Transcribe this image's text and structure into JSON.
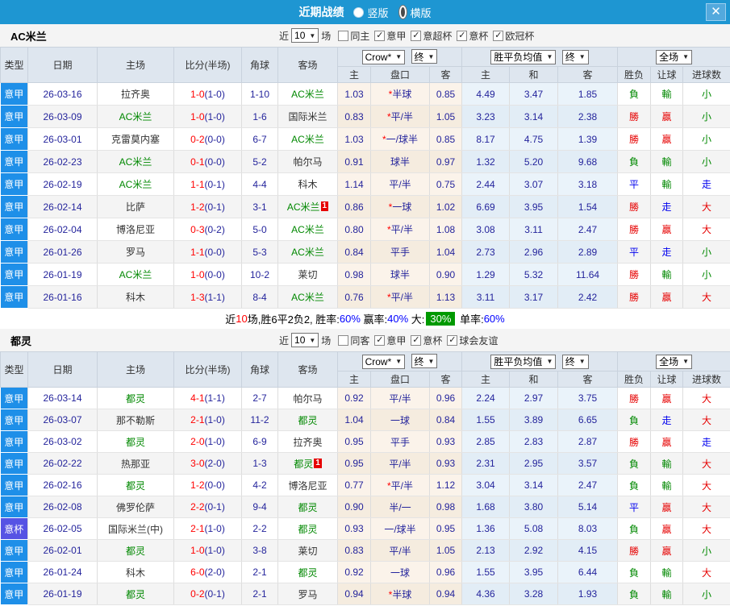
{
  "titlebar": {
    "title": "近期战绩",
    "layout_options": [
      {
        "label": "竖版",
        "selected": false
      },
      {
        "label": "横版",
        "selected": true
      }
    ],
    "close_label": "✕"
  },
  "colors": {
    "titlebar_bg": "#1e96d2",
    "league_serie_a": "#1e8fe8",
    "league_cup": "#5653e4",
    "focus_team": "#008800",
    "win": "#e60000",
    "lose": "#008800",
    "draw": "#0000ee",
    "score": "#ff0000",
    "numbers": "#24249c",
    "summary_badge_bg": "#009900"
  },
  "columns": {
    "left": [
      "类型",
      "日期",
      "主场",
      "比分(半场)",
      "角球",
      "客场"
    ],
    "odds_select": "Crow*",
    "odds_final_select": "终",
    "odds_sub": [
      "主",
      "盘口",
      "客"
    ],
    "mean_select": "胜平负均值",
    "mean_final_select": "终",
    "mean_sub": [
      "主",
      "和",
      "客"
    ],
    "full_select": "全场",
    "result_sub": [
      "胜负",
      "让球",
      "进球数"
    ]
  },
  "sections": [
    {
      "team": "AC米兰",
      "filter": {
        "near": "近",
        "count": "10",
        "games": "场",
        "checkboxes": [
          {
            "label": "同主",
            "checked": false
          },
          {
            "label": "意甲",
            "checked": true
          },
          {
            "label": "意超杯",
            "checked": true
          },
          {
            "label": "意杯",
            "checked": true
          },
          {
            "label": "欧冠杯",
            "checked": true
          }
        ]
      },
      "rows": [
        {
          "lg": "意甲",
          "lgc": "blue",
          "date": "26-03-16",
          "home": "拉齐奥",
          "hf": false,
          "hb": "",
          "score": "1-0",
          "half": "(1-0)",
          "corner": "1-10",
          "away": "AC米兰",
          "af": true,
          "ab": "",
          "o1": "1.03",
          "pan": "*半球",
          "o2": "0.85",
          "m1": "4.49",
          "m2": "3.47",
          "m3": "1.85",
          "r1": "負",
          "r1c": "g",
          "r2": "輸",
          "r2c": "g",
          "r3": "小",
          "r3c": "g"
        },
        {
          "lg": "意甲",
          "lgc": "blue",
          "date": "26-03-09",
          "home": "AC米兰",
          "hf": true,
          "hb": "",
          "score": "1-0",
          "half": "(1-0)",
          "corner": "1-6",
          "away": "国际米兰",
          "af": false,
          "ab": "",
          "o1": "0.83",
          "pan": "*平/半",
          "o2": "1.05",
          "m1": "3.23",
          "m2": "3.14",
          "m3": "2.38",
          "r1": "勝",
          "r1c": "r",
          "r2": "贏",
          "r2c": "r",
          "r3": "小",
          "r3c": "g"
        },
        {
          "lg": "意甲",
          "lgc": "blue",
          "date": "26-03-01",
          "home": "克雷莫内塞",
          "hf": false,
          "hb": "",
          "score": "0-2",
          "half": "(0-0)",
          "corner": "6-7",
          "away": "AC米兰",
          "af": true,
          "ab": "",
          "o1": "1.03",
          "pan": "*一/球半",
          "o2": "0.85",
          "m1": "8.17",
          "m2": "4.75",
          "m3": "1.39",
          "r1": "勝",
          "r1c": "r",
          "r2": "贏",
          "r2c": "r",
          "r3": "小",
          "r3c": "g"
        },
        {
          "lg": "意甲",
          "lgc": "blue",
          "date": "26-02-23",
          "home": "AC米兰",
          "hf": true,
          "hb": "",
          "score": "0-1",
          "half": "(0-0)",
          "corner": "5-2",
          "away": "帕尔马",
          "af": false,
          "ab": "",
          "o1": "0.91",
          "pan": "球半",
          "o2": "0.97",
          "m1": "1.32",
          "m2": "5.20",
          "m3": "9.68",
          "r1": "負",
          "r1c": "g",
          "r2": "輸",
          "r2c": "g",
          "r3": "小",
          "r3c": "g"
        },
        {
          "lg": "意甲",
          "lgc": "blue",
          "date": "26-02-19",
          "home": "AC米兰",
          "hf": true,
          "hb": "",
          "score": "1-1",
          "half": "(0-1)",
          "corner": "4-4",
          "away": "科木",
          "af": false,
          "ab": "",
          "o1": "1.14",
          "pan": "平/半",
          "o2": "0.75",
          "m1": "2.44",
          "m2": "3.07",
          "m3": "3.18",
          "r1": "平",
          "r1c": "b",
          "r2": "輸",
          "r2c": "g",
          "r3": "走",
          "r3c": "b"
        },
        {
          "lg": "意甲",
          "lgc": "blue",
          "date": "26-02-14",
          "home": "比萨",
          "hf": false,
          "hb": "",
          "score": "1-2",
          "half": "(0-1)",
          "corner": "3-1",
          "away": "AC米兰",
          "af": true,
          "ab": "1",
          "o1": "0.86",
          "pan": "*一球",
          "o2": "1.02",
          "m1": "6.69",
          "m2": "3.95",
          "m3": "1.54",
          "r1": "勝",
          "r1c": "r",
          "r2": "走",
          "r2c": "b",
          "r3": "大",
          "r3c": "r"
        },
        {
          "lg": "意甲",
          "lgc": "blue",
          "date": "26-02-04",
          "home": "博洛尼亚",
          "hf": false,
          "hb": "",
          "score": "0-3",
          "half": "(0-2)",
          "corner": "5-0",
          "away": "AC米兰",
          "af": true,
          "ab": "",
          "o1": "0.80",
          "pan": "*平/半",
          "o2": "1.08",
          "m1": "3.08",
          "m2": "3.11",
          "m3": "2.47",
          "r1": "勝",
          "r1c": "r",
          "r2": "贏",
          "r2c": "r",
          "r3": "大",
          "r3c": "r"
        },
        {
          "lg": "意甲",
          "lgc": "blue",
          "date": "26-01-26",
          "home": "罗马",
          "hf": false,
          "hb": "",
          "score": "1-1",
          "half": "(0-0)",
          "corner": "5-3",
          "away": "AC米兰",
          "af": true,
          "ab": "",
          "o1": "0.84",
          "pan": "平手",
          "o2": "1.04",
          "m1": "2.73",
          "m2": "2.96",
          "m3": "2.89",
          "r1": "平",
          "r1c": "b",
          "r2": "走",
          "r2c": "b",
          "r3": "小",
          "r3c": "g"
        },
        {
          "lg": "意甲",
          "lgc": "blue",
          "date": "26-01-19",
          "home": "AC米兰",
          "hf": true,
          "hb": "",
          "score": "1-0",
          "half": "(0-0)",
          "corner": "10-2",
          "away": "莱切",
          "af": false,
          "ab": "",
          "o1": "0.98",
          "pan": "球半",
          "o2": "0.90",
          "m1": "1.29",
          "m2": "5.32",
          "m3": "11.64",
          "r1": "勝",
          "r1c": "r",
          "r2": "輸",
          "r2c": "g",
          "r3": "小",
          "r3c": "g"
        },
        {
          "lg": "意甲",
          "lgc": "blue",
          "date": "26-01-16",
          "home": "科木",
          "hf": false,
          "hb": "",
          "score": "1-3",
          "half": "(1-1)",
          "corner": "8-4",
          "away": "AC米兰",
          "af": true,
          "ab": "",
          "o1": "0.76",
          "pan": "*平/半",
          "o2": "1.13",
          "m1": "3.11",
          "m2": "3.17",
          "m3": "2.42",
          "r1": "勝",
          "r1c": "r",
          "r2": "贏",
          "r2c": "r",
          "r3": "大",
          "r3c": "r"
        }
      ],
      "summary": [
        {
          "t": "近",
          "c": "k"
        },
        {
          "t": "10",
          "c": "r"
        },
        {
          "t": "场,胜6平2负2, 胜率:",
          "c": "k"
        },
        {
          "t": "60%",
          "c": "b"
        },
        {
          "t": " 赢率:",
          "c": "k"
        },
        {
          "t": "40%",
          "c": "b"
        },
        {
          "t": " 大:",
          "c": "k"
        },
        {
          "t": "30%",
          "c": "g"
        },
        {
          "t": " 单率:",
          "c": "k"
        },
        {
          "t": "60%",
          "c": "b"
        }
      ]
    },
    {
      "team": "都灵",
      "filter": {
        "near": "近",
        "count": "10",
        "games": "场",
        "checkboxes": [
          {
            "label": "同客",
            "checked": false
          },
          {
            "label": "意甲",
            "checked": true
          },
          {
            "label": "意杯",
            "checked": true
          },
          {
            "label": "球会友谊",
            "checked": true
          }
        ]
      },
      "rows": [
        {
          "lg": "意甲",
          "lgc": "blue",
          "date": "26-03-14",
          "home": "都灵",
          "hf": true,
          "hb": "",
          "score": "4-1",
          "half": "(1-1)",
          "corner": "2-7",
          "away": "帕尔马",
          "af": false,
          "ab": "",
          "o1": "0.92",
          "pan": "平/半",
          "o2": "0.96",
          "m1": "2.24",
          "m2": "2.97",
          "m3": "3.75",
          "r1": "勝",
          "r1c": "r",
          "r2": "贏",
          "r2c": "r",
          "r3": "大",
          "r3c": "r"
        },
        {
          "lg": "意甲",
          "lgc": "blue",
          "date": "26-03-07",
          "home": "那不勒斯",
          "hf": false,
          "hb": "",
          "score": "2-1",
          "half": "(1-0)",
          "corner": "11-2",
          "away": "都灵",
          "af": true,
          "ab": "",
          "o1": "1.04",
          "pan": "一球",
          "o2": "0.84",
          "m1": "1.55",
          "m2": "3.89",
          "m3": "6.65",
          "r1": "負",
          "r1c": "g",
          "r2": "走",
          "r2c": "b",
          "r3": "大",
          "r3c": "r"
        },
        {
          "lg": "意甲",
          "lgc": "blue",
          "date": "26-03-02",
          "home": "都灵",
          "hf": true,
          "hb": "",
          "score": "2-0",
          "half": "(1-0)",
          "corner": "6-9",
          "away": "拉齐奥",
          "af": false,
          "ab": "",
          "o1": "0.95",
          "pan": "平手",
          "o2": "0.93",
          "m1": "2.85",
          "m2": "2.83",
          "m3": "2.87",
          "r1": "勝",
          "r1c": "r",
          "r2": "贏",
          "r2c": "r",
          "r3": "走",
          "r3c": "b"
        },
        {
          "lg": "意甲",
          "lgc": "blue",
          "date": "26-02-22",
          "home": "热那亚",
          "hf": false,
          "hb": "",
          "score": "3-0",
          "half": "(2-0)",
          "corner": "1-3",
          "away": "都灵",
          "af": true,
          "ab": "1",
          "o1": "0.95",
          "pan": "平/半",
          "o2": "0.93",
          "m1": "2.31",
          "m2": "2.95",
          "m3": "3.57",
          "r1": "負",
          "r1c": "g",
          "r2": "輸",
          "r2c": "g",
          "r3": "大",
          "r3c": "r"
        },
        {
          "lg": "意甲",
          "lgc": "blue",
          "date": "26-02-16",
          "home": "都灵",
          "hf": true,
          "hb": "",
          "score": "1-2",
          "half": "(0-0)",
          "corner": "4-2",
          "away": "博洛尼亚",
          "af": false,
          "ab": "",
          "o1": "0.77",
          "pan": "*平/半",
          "o2": "1.12",
          "m1": "3.04",
          "m2": "3.14",
          "m3": "2.47",
          "r1": "負",
          "r1c": "g",
          "r2": "輸",
          "r2c": "g",
          "r3": "大",
          "r3c": "r"
        },
        {
          "lg": "意甲",
          "lgc": "blue",
          "date": "26-02-08",
          "home": "佛罗伦萨",
          "hf": false,
          "hb": "",
          "score": "2-2",
          "half": "(0-1)",
          "corner": "9-4",
          "away": "都灵",
          "af": true,
          "ab": "",
          "o1": "0.90",
          "pan": "半/一",
          "o2": "0.98",
          "m1": "1.68",
          "m2": "3.80",
          "m3": "5.14",
          "r1": "平",
          "r1c": "b",
          "r2": "贏",
          "r2c": "r",
          "r3": "大",
          "r3c": "r"
        },
        {
          "lg": "意杯",
          "lgc": "purple",
          "date": "26-02-05",
          "home": "国际米兰(中)",
          "hf": false,
          "hb": "",
          "score": "2-1",
          "half": "(1-0)",
          "corner": "2-2",
          "away": "都灵",
          "af": true,
          "ab": "",
          "o1": "0.93",
          "pan": "一/球半",
          "o2": "0.95",
          "m1": "1.36",
          "m2": "5.08",
          "m3": "8.03",
          "r1": "負",
          "r1c": "g",
          "r2": "贏",
          "r2c": "r",
          "r3": "大",
          "r3c": "r"
        },
        {
          "lg": "意甲",
          "lgc": "blue",
          "date": "26-02-01",
          "home": "都灵",
          "hf": true,
          "hb": "",
          "score": "1-0",
          "half": "(1-0)",
          "corner": "3-8",
          "away": "莱切",
          "af": false,
          "ab": "",
          "o1": "0.83",
          "pan": "平/半",
          "o2": "1.05",
          "m1": "2.13",
          "m2": "2.92",
          "m3": "4.15",
          "r1": "勝",
          "r1c": "r",
          "r2": "贏",
          "r2c": "r",
          "r3": "小",
          "r3c": "g"
        },
        {
          "lg": "意甲",
          "lgc": "blue",
          "date": "26-01-24",
          "home": "科木",
          "hf": false,
          "hb": "",
          "score": "6-0",
          "half": "(2-0)",
          "corner": "2-1",
          "away": "都灵",
          "af": true,
          "ab": "",
          "o1": "0.92",
          "pan": "一球",
          "o2": "0.96",
          "m1": "1.55",
          "m2": "3.95",
          "m3": "6.44",
          "r1": "負",
          "r1c": "g",
          "r2": "輸",
          "r2c": "g",
          "r3": "大",
          "r3c": "r"
        },
        {
          "lg": "意甲",
          "lgc": "blue",
          "date": "26-01-19",
          "home": "都灵",
          "hf": true,
          "hb": "",
          "score": "0-2",
          "half": "(0-1)",
          "corner": "2-1",
          "away": "罗马",
          "af": false,
          "ab": "",
          "o1": "0.94",
          "pan": "*半球",
          "o2": "0.94",
          "m1": "4.36",
          "m2": "3.28",
          "m3": "1.93",
          "r1": "負",
          "r1c": "g",
          "r2": "輸",
          "r2c": "g",
          "r3": "小",
          "r3c": "g"
        }
      ],
      "summary": null
    }
  ]
}
